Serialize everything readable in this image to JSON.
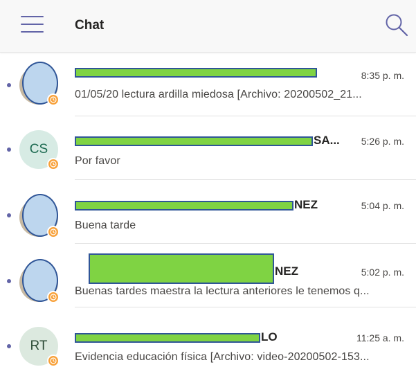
{
  "header": {
    "title": "Chat",
    "menu_icon": "hamburger-menu-icon",
    "search_icon": "search-icon"
  },
  "colors": {
    "accent": "#6264a7",
    "status_away": "#f8a13a",
    "redaction_fill": "#7fd343",
    "redaction_border": "#2f5597",
    "photo_mask": "#bdd6ee"
  },
  "chats": [
    {
      "name": "",
      "time": "8:35 p. m.",
      "preview": "01/05/20 lectura ardilla miedosa [Archivo: 20200502_21...",
      "avatar": {
        "type": "photo"
      },
      "status": "away"
    },
    {
      "name": "SA...",
      "time": "5:26 p. m.",
      "preview": "Por favor",
      "avatar": {
        "type": "initials",
        "initials": "CS",
        "bg": "#d7ebe4",
        "color": "#1e6b52"
      },
      "status": "away"
    },
    {
      "name": "NEZ",
      "time": "5:04 p. m.",
      "preview": "Buena tarde",
      "avatar": {
        "type": "photo"
      },
      "status": "away"
    },
    {
      "name": "NEZ",
      "time": "5:02 p. m.",
      "preview": "Buenas tardes maestra la lectura anteriores le tenemos q...",
      "avatar": {
        "type": "photo"
      },
      "status": "away"
    },
    {
      "name": "LO",
      "time": "11:25 a. m.",
      "preview": "Evidencia educación física [Archivo: video-20200502-153...",
      "avatar": {
        "type": "initials",
        "initials": "RT",
        "bg": "#dce9df",
        "color": "#2b4a35"
      },
      "status": "away"
    }
  ]
}
